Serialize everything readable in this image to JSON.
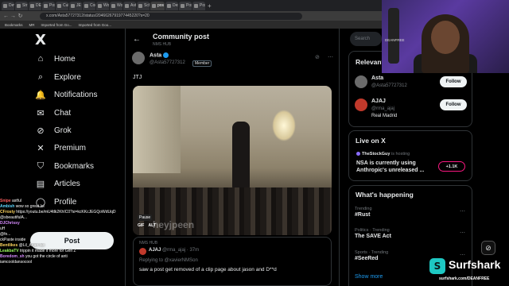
{
  "browser": {
    "tabs": [
      "Dev",
      "Str",
      "DE",
      "Pos",
      "Cull",
      "JE",
      "Cor",
      "Wo",
      "Wo",
      "Asti",
      "Sch",
      "pos",
      "Des",
      "Pos",
      "Pos"
    ],
    "url": "x.com/Asta57727312/status/2046626791977445220?s=20",
    "bookmarks": [
      "Bookmarks",
      "MR",
      "Imported from Go...",
      "Imported from Goo..."
    ]
  },
  "nav": {
    "logo": "X",
    "items": [
      {
        "label": "Home",
        "icon": "⌂"
      },
      {
        "label": "Explore",
        "icon": "⌕"
      },
      {
        "label": "Notifications",
        "icon": "🔔"
      },
      {
        "label": "Chat",
        "icon": "✉"
      },
      {
        "label": "Grok",
        "icon": "⊘"
      },
      {
        "label": "Premium",
        "icon": "✕"
      },
      {
        "label": "Bookmarks",
        "icon": "⛉"
      },
      {
        "label": "Articles",
        "icon": "▤"
      },
      {
        "label": "Profile",
        "icon": "◯"
      }
    ],
    "post_label": "Post"
  },
  "chat": [
    {
      "user": "Snipe",
      "text": "astful"
    },
    {
      "user": "Ambish",
      "text": "wow so great lol"
    },
    {
      "user": "CFrosty",
      "text": "https://youtu.be/mU4tlk2KhIC0?si=kcKKcJEGQoWdUqD"
    },
    {
      "user": "",
      "text": "@sbeautifulA..."
    },
    {
      "user": "DJChrissy",
      "text": ""
    },
    {
      "user": "",
      "text": "uH"
    },
    {
      "user": "",
      "text": "@fe..."
    },
    {
      "user": "",
      "text": "ckPaste inside"
    },
    {
      "user": "Bentlikes",
      "text": "@Lil_Arjan fax"
    },
    {
      "user": "LeakbaTV",
      "text": "trippin it made it more for Gen Z"
    },
    {
      "user": "Boredom_sh",
      "text": "you got the circle of anti"
    },
    {
      "user": "",
      "text": "iamcooldansocool"
    }
  ],
  "post": {
    "header_title": "Community post",
    "header_sub": "NMS HUB",
    "author_name": "Asta",
    "author_handle": "@Asta57727312",
    "member_badge": "Member",
    "text": "JTJ",
    "pause_label": "Pause",
    "gif_badges": "GIF ALT",
    "watermark": "heyjpeen",
    "quote": {
      "group": "NMS HUB",
      "name": "AJAJ",
      "handle": "@rma_ajaj · 37m",
      "reply_to": "Replying to @xavierNMSon",
      "text": "saw a post get removed of a clip page about jason and D**d"
    }
  },
  "right": {
    "search_placeholder": "Search",
    "relevant_title": "Relevant people",
    "people": [
      {
        "name": "Asta",
        "handle": "@Asta57727312",
        "bio": "",
        "follow": "Follow",
        "avatar_color": "#6b6b6b"
      },
      {
        "name": "AJAJ",
        "handle": "@rma_ajaj",
        "bio": "Real Madrid",
        "follow": "Follow",
        "avatar_color": "#c0392b"
      }
    ],
    "live": {
      "title": "Live on X",
      "host": "TheStockGuy",
      "host_suffix": "is hosting",
      "text": "NSA is currently using Anthropic's unreleased ...",
      "count": "+1.1K"
    },
    "happening": {
      "title": "What's happening",
      "trends": [
        {
          "context": "Trending",
          "name": "#Rust"
        },
        {
          "context": "Politics · Trending",
          "name": "The SAVE Act"
        },
        {
          "context": "Sports · Trending",
          "name": "#SeeRed"
        }
      ],
      "show_more": "Show more"
    }
  },
  "overlay": {
    "sponsor_name": "Surfshark",
    "sponsor_logo": "S",
    "sponsor_url": "surfshark.com/DEANFREE",
    "cam_label": "DEANFREE"
  },
  "colors": {
    "accent": "#1d9bf0",
    "background": "#000000",
    "sponsor": "#1ec8c3",
    "live": "#f91880"
  }
}
